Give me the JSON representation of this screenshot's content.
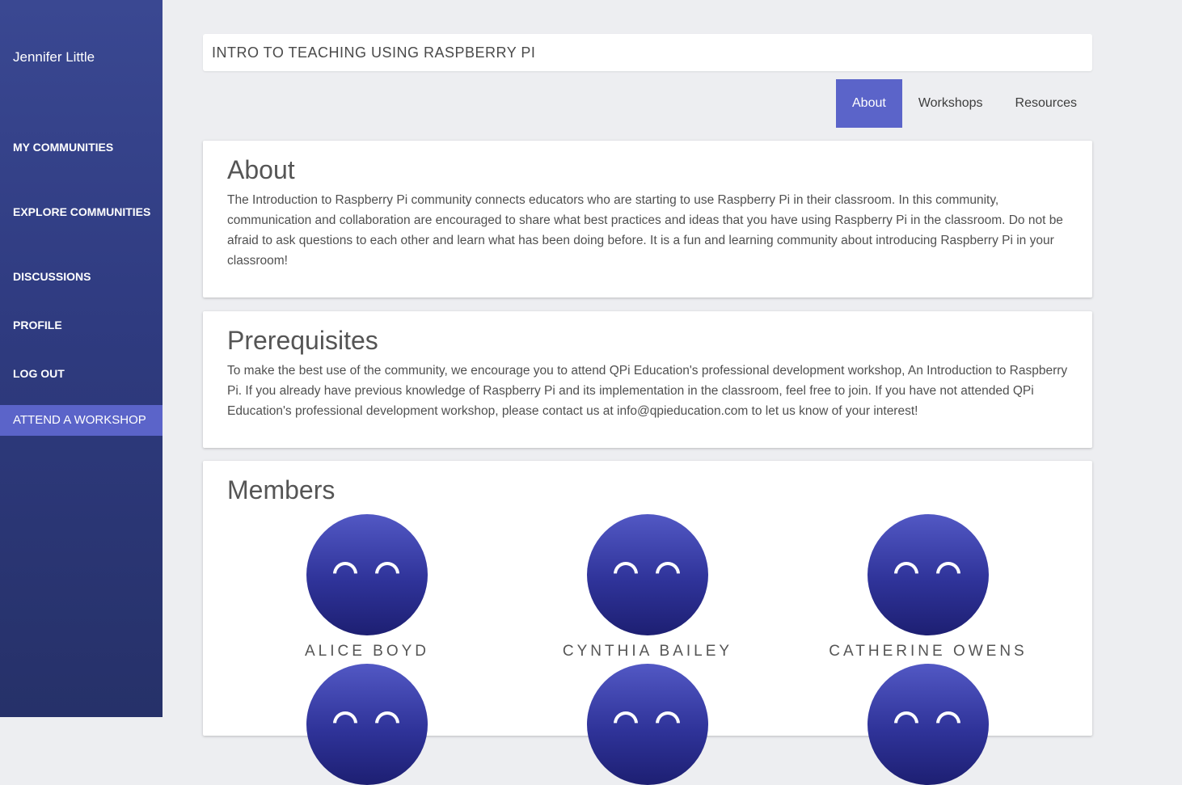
{
  "sidebar": {
    "user_name": "Jennifer Little",
    "items": [
      {
        "label": "MY COMMUNITIES"
      },
      {
        "label": "EXPLORE COMMUNITIES"
      },
      {
        "label": "DISCUSSIONS"
      },
      {
        "label": "PROFILE"
      },
      {
        "label": "LOG OUT"
      },
      {
        "label": "ATTEND A WORKSHOP"
      }
    ]
  },
  "header": {
    "title": "INTRO TO TEACHING USING RASPBERRY PI"
  },
  "tabs": [
    {
      "label": "About",
      "active": true
    },
    {
      "label": "Workshops",
      "active": false
    },
    {
      "label": "Resources",
      "active": false
    }
  ],
  "about": {
    "heading": "About",
    "body": "The Introduction to Raspberry Pi community connects educators who are starting to use Raspberry Pi in their classroom. In this community, communication and collaboration are encouraged to share what best practices and ideas that you have using Raspberry Pi in the classroom. Do not be afraid to ask questions to each other and learn what has been doing before. It is a fun and learning community about introducing Raspberry Pi in your classroom!"
  },
  "prerequisites": {
    "heading": "Prerequisites",
    "body": "To make the best use of the community, we encourage you to attend QPi Education's professional development workshop, An Introduction to Raspberry Pi. If you already have previous knowledge of Raspberry Pi and its implementation in the classroom, feel free to join. If you have not attended QPi Education's professional development workshop, please contact us at info@qpieducation.com to let us know of your interest!"
  },
  "members": {
    "heading": "Members",
    "list": [
      {
        "name": "ALICE BOYD"
      },
      {
        "name": "CYNTHIA BAILEY"
      },
      {
        "name": "CATHERINE OWENS"
      }
    ]
  },
  "colors": {
    "accent": "#5b64c9",
    "sidebar": "#2f3b80",
    "avatar": "#2f3399"
  }
}
